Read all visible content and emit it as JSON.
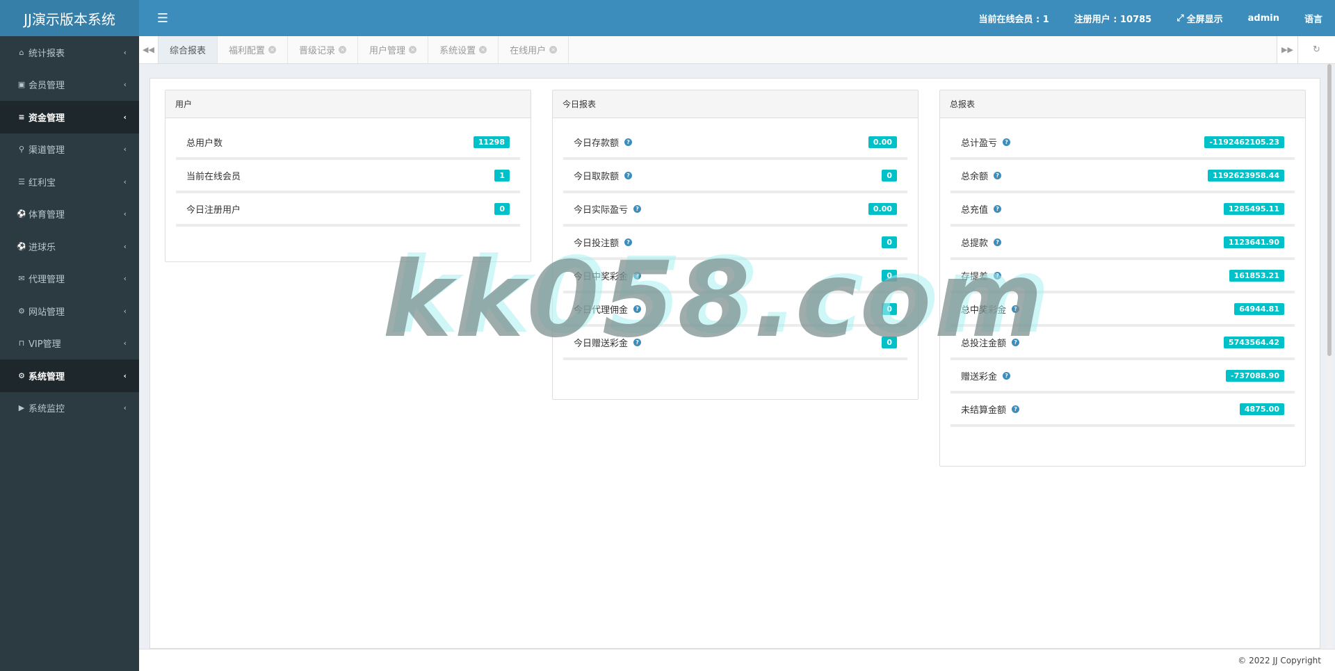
{
  "app": {
    "title": "JJ演示版本系统"
  },
  "header": {
    "online_members": "当前在线会员 : 1",
    "registered_users": "注册用户 : 10785",
    "fullscreen": "全屏显示",
    "user": "admin",
    "language": "语言"
  },
  "sidebar": {
    "items": [
      {
        "label": "统计报表",
        "icon": "home-icon"
      },
      {
        "label": "会员管理",
        "icon": "member-card-icon"
      },
      {
        "label": "资金管理",
        "icon": "database-icon"
      },
      {
        "label": "渠道管理",
        "icon": "channel-icon"
      },
      {
        "label": "红利宝",
        "icon": "list-icon"
      },
      {
        "label": "体育管理",
        "icon": "soccer-ball-icon"
      },
      {
        "label": "进球乐",
        "icon": "soccer-ball-icon"
      },
      {
        "label": "代理管理",
        "icon": "envelope-icon"
      },
      {
        "label": "网站管理",
        "icon": "cogs-icon"
      },
      {
        "label": "VIP管理",
        "icon": "lock-icon"
      },
      {
        "label": "系统管理",
        "icon": "gear-icon"
      },
      {
        "label": "系统监控",
        "icon": "video-camera-icon"
      }
    ]
  },
  "tabs": [
    {
      "label": "综合报表"
    },
    {
      "label": "福利配置"
    },
    {
      "label": "晋级记录"
    },
    {
      "label": "用户管理"
    },
    {
      "label": "系统设置"
    },
    {
      "label": "在线用户"
    }
  ],
  "panels": {
    "users": {
      "title": "用户",
      "rows": [
        {
          "label": "总用户数",
          "value": "11298"
        },
        {
          "label": "当前在线会员",
          "value": "1"
        },
        {
          "label": "今日注册用户",
          "value": "0"
        }
      ]
    },
    "today": {
      "title": "今日报表",
      "rows": [
        {
          "label": "今日存款额",
          "value": "0.00"
        },
        {
          "label": "今日取款额",
          "value": "0"
        },
        {
          "label": "今日实际盈亏",
          "value": "0.00"
        },
        {
          "label": "今日投注额",
          "value": "0"
        },
        {
          "label": "今日中奖彩金",
          "value": "0"
        },
        {
          "label": "今日代理佣金",
          "value": "0"
        },
        {
          "label": "今日赠送彩金",
          "value": "0"
        }
      ]
    },
    "total": {
      "title": "总报表",
      "rows": [
        {
          "label": "总计盈亏",
          "value": "-1192462105.23"
        },
        {
          "label": "总余额",
          "value": "1192623958.44"
        },
        {
          "label": "总充值",
          "value": "1285495.11"
        },
        {
          "label": "总提款",
          "value": "1123641.90"
        },
        {
          "label": "存提差",
          "value": "161853.21"
        },
        {
          "label": "总中奖彩金",
          "value": "64944.81"
        },
        {
          "label": "总投注金额",
          "value": "5743564.42"
        },
        {
          "label": "赠送彩金",
          "value": "-737088.90"
        },
        {
          "label": "未结算金额",
          "value": "4875.00"
        }
      ]
    }
  },
  "watermark": "kk058.com",
  "footer": {
    "copyright": "© 2022 JJ Copyright"
  },
  "colors": {
    "header": "#3c8dbc",
    "logo": "#367fa9",
    "sidebar": "#2c3b41",
    "badge": "#00c0c8"
  }
}
